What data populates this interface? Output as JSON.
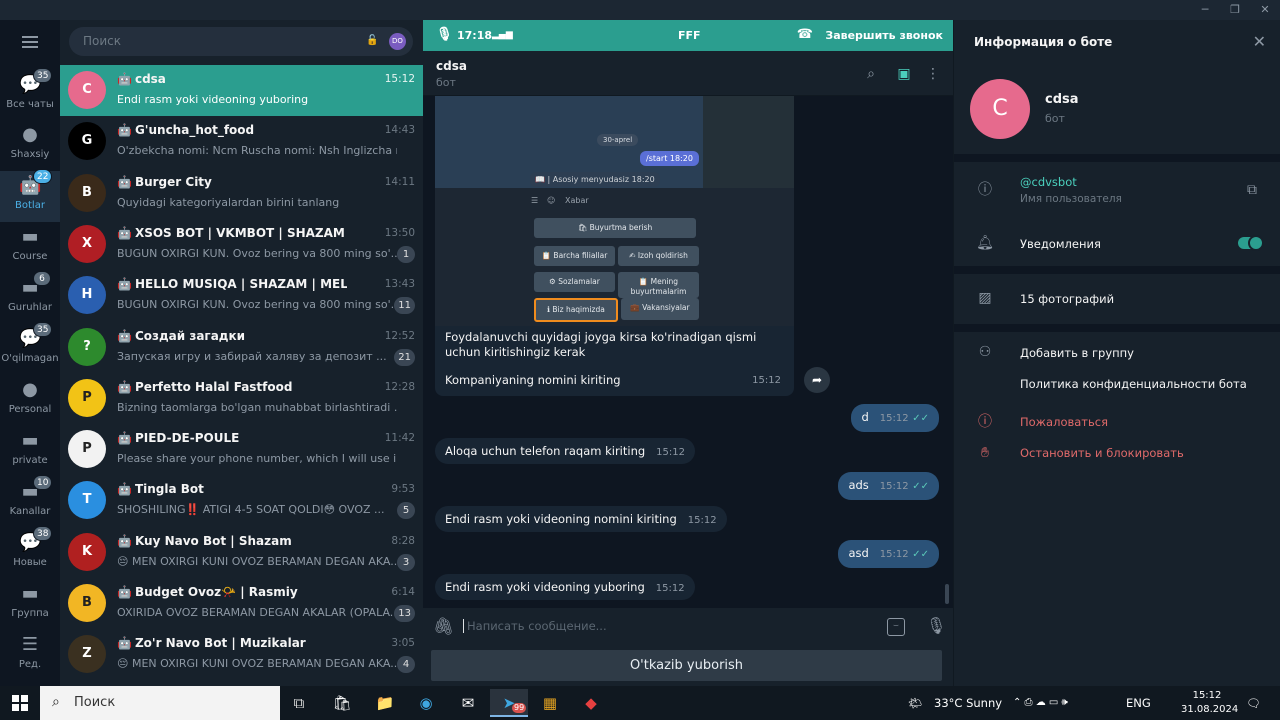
{
  "rail": {
    "folders": [
      {
        "label": "Все чаты",
        "badge": "35",
        "icon": "chat-icon"
      },
      {
        "label": "Shaxsiy",
        "badge": "",
        "icon": "person-icon"
      },
      {
        "label": "Botlar",
        "badge": "22",
        "icon": "bot-icon",
        "active": true
      },
      {
        "label": "Course",
        "badge": "",
        "icon": "folder-icon"
      },
      {
        "label": "Guruhlar",
        "badge": "6",
        "icon": "folder-icon"
      },
      {
        "label": "O'qilmagan",
        "badge": "35",
        "icon": "chat-icon"
      },
      {
        "label": "Personal",
        "badge": "",
        "icon": "person-icon"
      },
      {
        "label": "private",
        "badge": "",
        "icon": "folder-icon"
      },
      {
        "label": "Kanallar",
        "badge": "10",
        "icon": "folder-icon"
      },
      {
        "label": "Новые",
        "badge": "38",
        "icon": "chat-icon"
      },
      {
        "label": "Группа",
        "badge": "",
        "icon": "folder-icon"
      },
      {
        "label": "Ред.",
        "badge": "",
        "icon": "sliders-icon"
      }
    ]
  },
  "search": {
    "placeholder": "Поиск",
    "avatar_initials": "DO"
  },
  "chats": [
    {
      "name": "cdsa",
      "time": "15:12",
      "preview": "Endi rasm yoki videoning yuboring",
      "unread": "",
      "avatar": "C",
      "color": "#e66a8d",
      "active": true
    },
    {
      "name": "G'uncha_hot_food",
      "time": "14:43",
      "preview": "O'zbekcha nomi: Ncm Ruscha nomi: Nsh Inglizcha no...",
      "unread": "",
      "avatar": "G",
      "color": "#000000"
    },
    {
      "name": "Burger City",
      "time": "14:11",
      "preview": "Quyidagi kategoriyalardan  birini tanlang",
      "unread": "",
      "avatar": "B",
      "color": "#3a2a1a"
    },
    {
      "name": "XSOS BOT | VKMBOT | SHAZAM | MUZIKA",
      "time": "13:50",
      "preview": "BUGUN OXIRGI KUN.  Ovoz bering va 800 ming so'...",
      "unread": "1",
      "avatar": "X",
      "color": "#b01e24"
    },
    {
      "name": "HELLO MUSIQA | SHAZAM | MELLSTROY",
      "time": "13:43",
      "preview": "BUGUN OXIRGI KUN.  Ovoz bering va 800 ming so'...",
      "unread": "11",
      "avatar": "H",
      "color": "#2a5fb0"
    },
    {
      "name": "Создай загадки",
      "time": "12:52",
      "preview": "Запуская игру и забирай халяву за депозит ...",
      "unread": "21",
      "avatar": "?",
      "color": "#2d8a2d"
    },
    {
      "name": "Perfetto Halal Fastfood",
      "time": "12:28",
      "preview": "Bizning taomlarga bo'lgan muhabbat birlashtiradi ...",
      "unread": "",
      "avatar": "P",
      "color": "#f2c316"
    },
    {
      "name": "PIED-DE-POULE",
      "time": "11:42",
      "preview": "Please share your phone number, which I will use in the f...",
      "unread": "",
      "avatar": "P",
      "color": "#f2f2f2"
    },
    {
      "name": "Tingla Bot",
      "time": "9:53",
      "preview": "SHOSHILING‼️ ATIGI 4-5 SOAT QOLDI😳  OVOZ ...",
      "unread": "5",
      "avatar": "T",
      "color": "#2a8fe0"
    },
    {
      "name": "Kuy Navo Bot | Shazam",
      "time": "8:28",
      "preview": "😔 MEN OXIRGI KUNI OVOZ BERAMAN DEGAN AKA...",
      "unread": "3",
      "avatar": "K",
      "color": "#b02020"
    },
    {
      "name": "Budget Ovoz📯 | Rasmiy",
      "time": "6:14",
      "preview": "OXIRIDA OVOZ BERAMAN DEGAN AKALAR (OPALA...",
      "unread": "13",
      "avatar": "B",
      "color": "#f2b624"
    },
    {
      "name": "Zo'r Navo Bot | Muzikalar",
      "time": "3:05",
      "preview": "😔 MEN OXIRGI KUNI OVOZ BERAMAN DEGAN AKA...",
      "unread": "4",
      "avatar": "Z",
      "color": "#3a3020"
    }
  ],
  "call": {
    "time": "17:18",
    "title": "FFF",
    "end_label": "Завершить звонок"
  },
  "chat": {
    "title": "cdsa",
    "subtitle": "бот",
    "photo": {
      "date": "30-aprel",
      "start": "/start",
      "start_time": "18:20",
      "menu_line": "📖 | Asosiy menyudasiz",
      "menu_time": "18:20",
      "input_placeholder": "Xabar",
      "buttons": [
        "🛍 Buyurtma berish",
        "📋 Barcha filiallar",
        "✍ Izoh qoldirish",
        "⚙ Sozlamalar",
        "📋 Mening buyurtmalarim",
        "ℹ Biz haqimizda",
        "💼 Vakansiyalar"
      ]
    },
    "photo_caption": "Foydalanuvchi quyidagi joyga kirsa ko'rinadigan qismi uchun kiritishingiz kerak",
    "photo_caption2": "Kompaniyaning nomini kiriting",
    "photo_time": "15:12",
    "messages": [
      {
        "dir": "out",
        "text": "d",
        "time": "15:12"
      },
      {
        "dir": "in",
        "text": "Aloqa uchun telefon raqam kiriting",
        "time": "15:12"
      },
      {
        "dir": "out",
        "text": "ads",
        "time": "15:12"
      },
      {
        "dir": "in",
        "text": "Endi rasm yoki videoning nomini kiriting",
        "time": "15:12"
      },
      {
        "dir": "out",
        "text": "asd",
        "time": "15:12"
      },
      {
        "dir": "in",
        "text": "Endi rasm yoki videoning yuboring",
        "time": "15:12"
      }
    ],
    "compose_placeholder": "Написать сообщение...",
    "send_label": "O'tkazib yuborish"
  },
  "info": {
    "header": "Информация о боте",
    "name": "cdsa",
    "subtitle": "бот",
    "avatar": "C",
    "username": "@cdvsbot",
    "username_label": "Имя пользователя",
    "notifications": "Уведомления",
    "notifications_on": true,
    "photos": "15 фотографий",
    "add_group": "Добавить в группу",
    "privacy": "Политика конфиденциальности бота",
    "report": "Пожаловаться",
    "block": "Остановить и блокировать"
  },
  "taskbar": {
    "search": "Поиск",
    "weather": "33°C  Sunny",
    "weather_badge": "1",
    "lang": "ENG",
    "time": "15:12",
    "date": "31.08.2024",
    "telegram_badge": "99"
  }
}
